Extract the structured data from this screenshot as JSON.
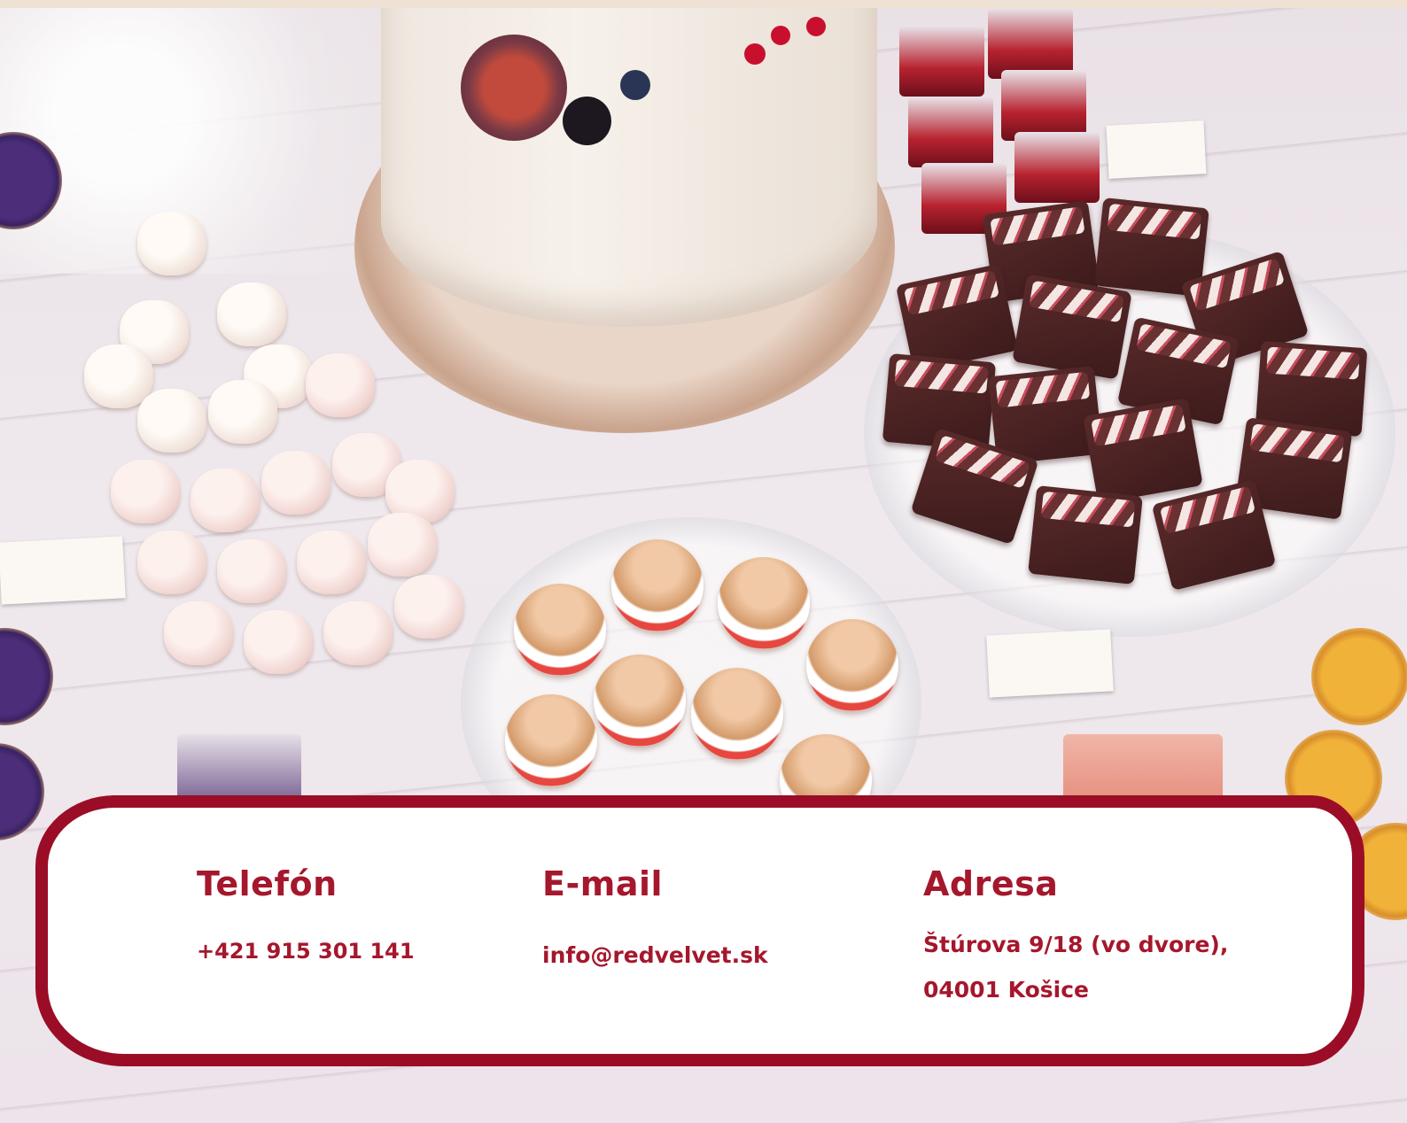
{
  "contact": {
    "phone": {
      "heading": "Telefón",
      "value": "+421 915 301 141"
    },
    "email": {
      "heading": "E-mail",
      "value": "info@redvelvet.sk"
    },
    "address": {
      "heading": "Adresa",
      "line1": "Štúrova 9/18 (vo dvore),",
      "line2": "04001 Košice"
    }
  },
  "colors": {
    "brand": "#9b0d26",
    "text": "#a5172c",
    "card": "#ffffff",
    "topbar": "#efe2d4"
  },
  "photo": {
    "subject": "dessert-table-photo"
  }
}
